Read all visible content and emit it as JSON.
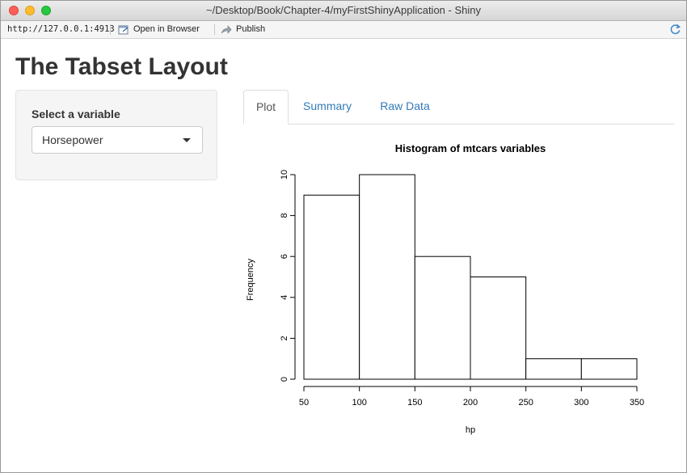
{
  "window": {
    "title": "~/Desktop/Book/Chapter-4/myFirstShinyApplication - Shiny"
  },
  "toolbar": {
    "url": "http://127.0.0.1:4913",
    "open_in_browser": "Open in Browser",
    "publish": "Publish"
  },
  "page": {
    "title": "The Tabset Layout"
  },
  "sidebar": {
    "select_label": "Select a variable",
    "select_value": "Horsepower"
  },
  "tabs": [
    {
      "label": "Plot",
      "active": true
    },
    {
      "label": "Summary",
      "active": false
    },
    {
      "label": "Raw Data",
      "active": false
    }
  ],
  "chart_data": {
    "type": "bar",
    "title": "Histogram of mtcars variables",
    "xlabel": "hp",
    "ylabel": "Frequency",
    "bins": [
      [
        50,
        100
      ],
      [
        100,
        150
      ],
      [
        150,
        200
      ],
      [
        200,
        250
      ],
      [
        250,
        300
      ],
      [
        300,
        350
      ]
    ],
    "values": [
      9,
      10,
      6,
      5,
      1,
      1
    ],
    "xlim": [
      50,
      350
    ],
    "ylim": [
      0,
      10
    ],
    "xticks": [
      50,
      100,
      150,
      200,
      250,
      300,
      350
    ],
    "yticks": [
      0,
      2,
      4,
      6,
      8,
      10
    ],
    "grid": false,
    "bar_fill": "#ffffff",
    "bar_stroke": "#000000"
  }
}
